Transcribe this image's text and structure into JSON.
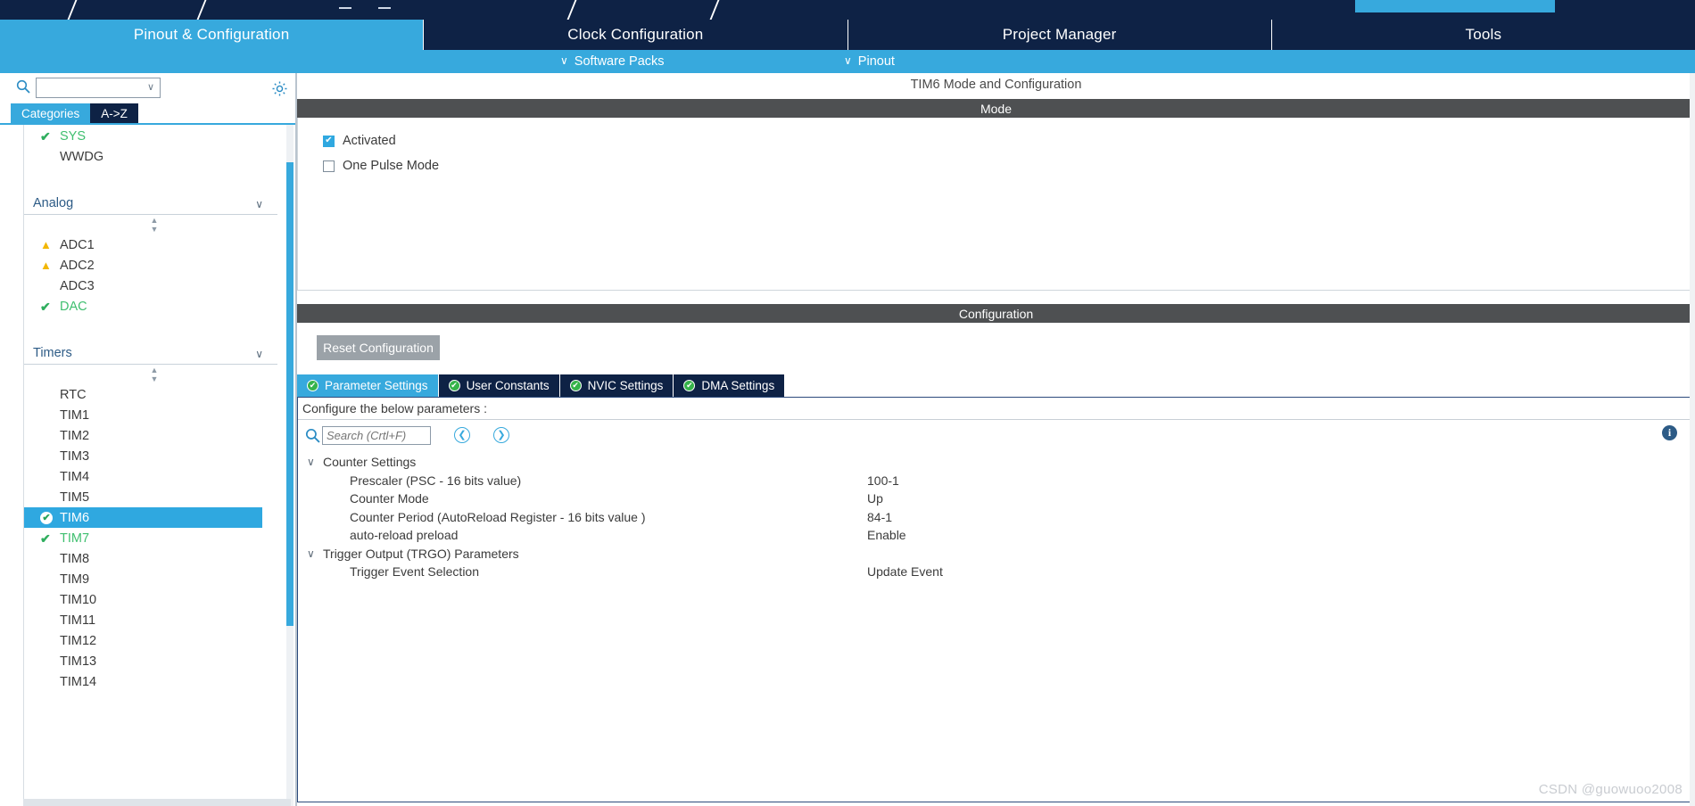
{
  "window": {
    "nav_tabs": [
      {
        "label": "Pinout & Configuration",
        "active": true
      },
      {
        "label": "Clock Configuration",
        "active": false
      },
      {
        "label": "Project Manager",
        "active": false
      },
      {
        "label": "Tools",
        "active": false
      }
    ],
    "subbar": {
      "software_packs": "Software Packs",
      "pinout": "Pinout"
    }
  },
  "sidebar": {
    "search_placeholder": "",
    "search_icon": "search-icon",
    "gear_icon": "gear-icon",
    "view_tabs": [
      {
        "label": "Categories",
        "active": true
      },
      {
        "label": "A->Z",
        "active": false
      }
    ],
    "top_items": [
      {
        "label": "SYS",
        "state": "ok"
      },
      {
        "label": "WWDG",
        "state": "none"
      }
    ],
    "groups": [
      {
        "title": "Analog",
        "items": [
          {
            "label": "ADC1",
            "state": "warn"
          },
          {
            "label": "ADC2",
            "state": "warn"
          },
          {
            "label": "ADC3",
            "state": "none"
          },
          {
            "label": "DAC",
            "state": "ok"
          }
        ]
      },
      {
        "title": "Timers",
        "items": [
          {
            "label": "RTC",
            "state": "none"
          },
          {
            "label": "TIM1",
            "state": "none"
          },
          {
            "label": "TIM2",
            "state": "none"
          },
          {
            "label": "TIM3",
            "state": "none"
          },
          {
            "label": "TIM4",
            "state": "none"
          },
          {
            "label": "TIM5",
            "state": "none"
          },
          {
            "label": "TIM6",
            "state": "selected"
          },
          {
            "label": "TIM7",
            "state": "ok"
          },
          {
            "label": "TIM8",
            "state": "none"
          },
          {
            "label": "TIM9",
            "state": "none"
          },
          {
            "label": "TIM10",
            "state": "none"
          },
          {
            "label": "TIM11",
            "state": "none"
          },
          {
            "label": "TIM12",
            "state": "none"
          },
          {
            "label": "TIM13",
            "state": "none"
          },
          {
            "label": "TIM14",
            "state": "none"
          }
        ]
      }
    ]
  },
  "main": {
    "title": "TIM6 Mode and Configuration",
    "mode": {
      "header": "Mode",
      "checkboxes": [
        {
          "label": "Activated",
          "checked": true
        },
        {
          "label": "One Pulse Mode",
          "checked": false
        }
      ]
    },
    "configuration": {
      "header": "Configuration",
      "reset_button": "Reset Configuration",
      "tabs": [
        {
          "label": "Parameter Settings",
          "active": true
        },
        {
          "label": "User Constants",
          "active": false
        },
        {
          "label": "NVIC Settings",
          "active": false
        },
        {
          "label": "DMA Settings",
          "active": false
        }
      ],
      "panel_header": "Configure the below parameters :",
      "search_placeholder": "Search (Crtl+F)",
      "prev_icon": "chevron-left-circle-icon",
      "next_icon": "chevron-right-circle-icon",
      "info_icon": "info-icon",
      "parameters": [
        {
          "type": "group",
          "name": "Counter Settings"
        },
        {
          "type": "item",
          "name": "Prescaler (PSC - 16 bits value)",
          "value": "100-1"
        },
        {
          "type": "item",
          "name": "Counter Mode",
          "value": "Up"
        },
        {
          "type": "item",
          "name": "Counter Period (AutoReload Register - 16 bits value )",
          "value": "84-1"
        },
        {
          "type": "item",
          "name": "auto-reload preload",
          "value": "Enable"
        },
        {
          "type": "group",
          "name": "Trigger Output (TRGO) Parameters"
        },
        {
          "type": "item",
          "name": "Trigger Event Selection",
          "value": "Update Event"
        }
      ]
    }
  },
  "watermark": "CSDN @guowuoo2008",
  "colors": {
    "accent": "#37a9dd",
    "navy": "#0e2245",
    "section_gray": "#4e5052",
    "ok_green": "#3fbf6f",
    "warn_yellow": "#f2b705"
  }
}
